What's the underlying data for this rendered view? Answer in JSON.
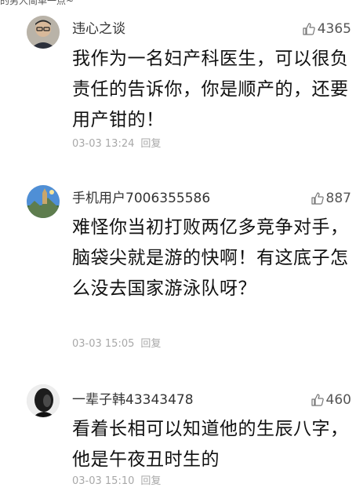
{
  "top_fragment": "的男人简单一点~",
  "comments": [
    {
      "avatar": "man-with-glasses-avatar",
      "username": "违心之谈",
      "likes": "4365",
      "content": "我作为一名妇产科医生，可以很负责任的告诉你，你是顺产的，还要用产钳的！",
      "time": "03-03 13:24",
      "reply": "回复"
    },
    {
      "avatar": "landscape-avatar",
      "username": "手机用户7006355586",
      "likes": "887",
      "content": "难怪你当初打败两亿多竞争对手，脑袋尖就是游的快啊！有这底子怎么没去国家游泳队呀？",
      "time": "03-03 15:05",
      "reply": "回复"
    },
    {
      "avatar": "dark-portrait-avatar",
      "username": "一辈子韩43343478",
      "likes": "460",
      "content": "看着长相可以知道他的生辰八字，他是午夜丑时生的",
      "time": "03-03 15:10",
      "reply": "回复"
    }
  ],
  "colors": {
    "text": "#111111",
    "username": "#333333",
    "meta": "#a8a8a8",
    "likes": "#555555"
  }
}
